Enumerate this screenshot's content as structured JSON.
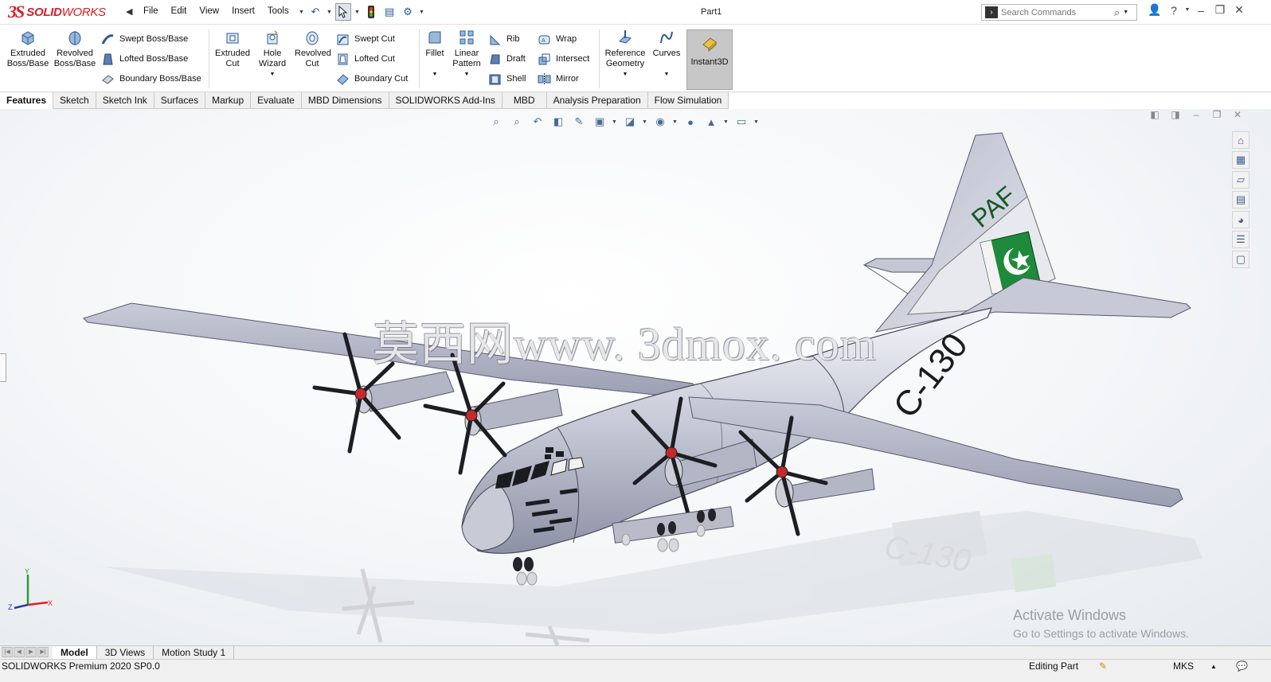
{
  "app": {
    "brand_ds": "3S",
    "brand_name_bold": "SOLID",
    "brand_name_rest": "WORKS",
    "document_title": "Part1"
  },
  "menu": [
    "File",
    "Edit",
    "View",
    "Insert",
    "Tools"
  ],
  "search": {
    "placeholder": "Search Commands"
  },
  "command_manager": {
    "extruded_boss": "Extruded Boss/Base",
    "revolved_boss": "Revolved Boss/Base",
    "swept_boss": "Swept Boss/Base",
    "lofted_boss": "Lofted Boss/Base",
    "boundary_boss": "Boundary Boss/Base",
    "extruded_cut": "Extruded Cut",
    "hole_wizard": "Hole Wizard",
    "revolved_cut": "Revolved Cut",
    "swept_cut": "Swept Cut",
    "lofted_cut": "Lofted Cut",
    "boundary_cut": "Boundary Cut",
    "fillet": "Fillet",
    "linear_pattern": "Linear Pattern",
    "rib": "Rib",
    "draft": "Draft",
    "shell": "Shell",
    "wrap": "Wrap",
    "intersect": "Intersect",
    "mirror": "Mirror",
    "reference_geometry": "Reference Geometry",
    "curves": "Curves",
    "instant3d": "Instant3D"
  },
  "tabs": [
    "Features",
    "Sketch",
    "Sketch Ink",
    "Surfaces",
    "Markup",
    "Evaluate",
    "MBD Dimensions",
    "SOLIDWORKS Add-Ins",
    "MBD",
    "Analysis Preparation",
    "Flow Simulation"
  ],
  "active_tab": "Features",
  "model": {
    "tail_text": "PAF",
    "fuselage_text": "C-130",
    "reflection_text": "C-130"
  },
  "overlay": {
    "watermark": "莫西网www. 3dmox. com",
    "activate_title": "Activate Windows",
    "activate_sub": "Go to Settings to activate Windows."
  },
  "triad": {
    "y": "Y",
    "x": "X",
    "z": "Z"
  },
  "bottom_tabs": [
    "Model",
    "3D Views",
    "Motion Study 1"
  ],
  "active_bottom_tab": "Model",
  "status": {
    "version": "SOLIDWORKS Premium 2020 SP0.0",
    "mode": "Editing Part",
    "units": "MKS"
  },
  "colors": {
    "brand_red": "#d6202a",
    "flag_green": "#1f8a3b",
    "aircraft_gray": "#a9adbe"
  },
  "icons": {
    "undo": "undo-icon",
    "select": "cursor-icon",
    "traffic": "rebuild-light-icon",
    "options": "gear-icon",
    "help": "help-icon",
    "user": "user-icon"
  }
}
